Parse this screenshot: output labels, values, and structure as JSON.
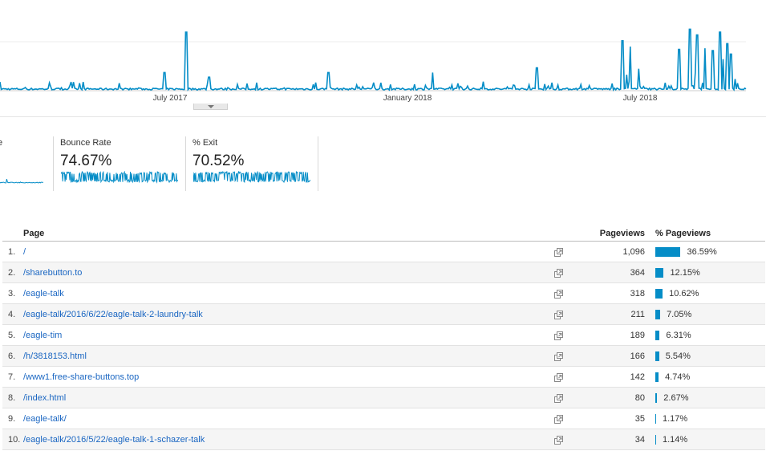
{
  "chart": {
    "line_color": "#058dc7",
    "x_labels": [
      "July 2017",
      "January 2018",
      "July 2018"
    ]
  },
  "metrics": [
    {
      "label": "e",
      "value": ""
    },
    {
      "label": "Bounce Rate",
      "value": "74.67%"
    },
    {
      "label": "% Exit",
      "value": "70.52%"
    }
  ],
  "table": {
    "headers": {
      "page": "Page",
      "pageviews": "Pageviews",
      "pct_pageviews": "% Pageviews"
    },
    "bar_color": "#058dc7",
    "rows": [
      {
        "index": "1.",
        "page": "/",
        "pageviews": "1,096",
        "pct": "36.59%",
        "pct_value": 36.59
      },
      {
        "index": "2.",
        "page": "/sharebutton.to",
        "pageviews": "364",
        "pct": "12.15%",
        "pct_value": 12.15
      },
      {
        "index": "3.",
        "page": "/eagle-talk",
        "pageviews": "318",
        "pct": "10.62%",
        "pct_value": 10.62
      },
      {
        "index": "4.",
        "page": "/eagle-talk/2016/6/22/eagle-talk-2-laundry-talk",
        "pageviews": "211",
        "pct": "7.05%",
        "pct_value": 7.05
      },
      {
        "index": "5.",
        "page": "/eagle-tim",
        "pageviews": "189",
        "pct": "6.31%",
        "pct_value": 6.31
      },
      {
        "index": "6.",
        "page": "/h/3818153.html",
        "pageviews": "166",
        "pct": "5.54%",
        "pct_value": 5.54
      },
      {
        "index": "7.",
        "page": "/www1.free-share-buttons.top",
        "pageviews": "142",
        "pct": "4.74%",
        "pct_value": 4.74
      },
      {
        "index": "8.",
        "page": "/index.html",
        "pageviews": "80",
        "pct": "2.67%",
        "pct_value": 2.67
      },
      {
        "index": "9.",
        "page": "/eagle-talk/",
        "pageviews": "35",
        "pct": "1.17%",
        "pct_value": 1.17
      },
      {
        "index": "10.",
        "page": "/eagle-talk/2016/5/22/eagle-talk-1-schazer-talk",
        "pageviews": "34",
        "pct": "1.14%",
        "pct_value": 1.14
      }
    ]
  }
}
